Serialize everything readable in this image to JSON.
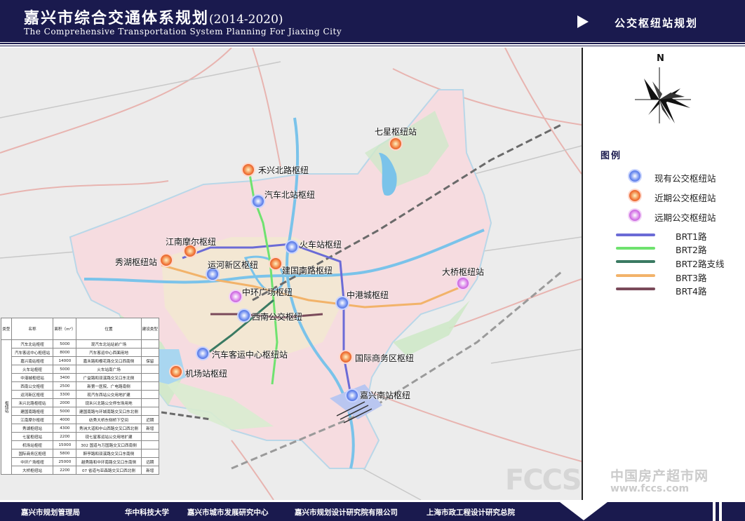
{
  "header": {
    "title": "嘉兴市综合交通体系规划",
    "years": "(2014-2020)",
    "subtitle": "The Comprehensive Transportation System Planning For Jiaxing City",
    "section_title": "公交枢纽站规划"
  },
  "compass": {
    "north_label": "N"
  },
  "legend": {
    "title": "图例",
    "items": [
      {
        "label": "现有公交枢纽站",
        "kind": "dot",
        "color": "#4a6fe0"
      },
      {
        "label": "近期公交枢纽站",
        "kind": "dot",
        "color": "#e8502a"
      },
      {
        "label": "远期公交枢纽站",
        "kind": "dot",
        "color": "#c050d8"
      },
      {
        "label": "BRT1路",
        "kind": "line",
        "color": "#6b6bd6"
      },
      {
        "label": "BRT2路",
        "kind": "line",
        "color": "#6fe26f"
      },
      {
        "label": "BRT2路支线",
        "kind": "line",
        "color": "#3a7a62"
      },
      {
        "label": "BRT3路",
        "kind": "line",
        "color": "#f2b36a"
      },
      {
        "label": "BRT4路",
        "kind": "line",
        "color": "#7a4a5a"
      }
    ]
  },
  "hubs": [
    {
      "name": "七星枢纽站",
      "type": "near"
    },
    {
      "name": "禾兴北路枢纽",
      "type": "near"
    },
    {
      "name": "汽车北站枢纽",
      "type": "existing"
    },
    {
      "name": "江南摩尔枢纽",
      "type": "near"
    },
    {
      "name": "秀湖枢纽站",
      "type": "near"
    },
    {
      "name": "运河新区枢纽",
      "type": "existing"
    },
    {
      "name": "火车站枢纽",
      "type": "existing"
    },
    {
      "name": "建国南路枢纽",
      "type": "near"
    },
    {
      "name": "大桥枢纽站",
      "type": "far"
    },
    {
      "name": "中环广场枢纽",
      "type": "far"
    },
    {
      "name": "中港城枢纽",
      "type": "existing"
    },
    {
      "name": "西南公交枢纽",
      "type": "existing"
    },
    {
      "name": "汽车客运中心枢纽站",
      "type": "existing"
    },
    {
      "name": "国际商务区枢纽",
      "type": "near"
    },
    {
      "name": "机场站枢纽",
      "type": "near"
    },
    {
      "name": "嘉兴南站枢纽",
      "type": "existing"
    }
  ],
  "table": {
    "headers": [
      "类型",
      "名称",
      "面积（m²）",
      "位置",
      "建设类型"
    ],
    "side_label": "枢纽站",
    "rows": [
      {
        "name": "汽车北站枢纽",
        "area": "5000",
        "location": "现汽车北站站前广场",
        "build": ""
      },
      {
        "name": "汽车客运中心枢纽站",
        "area": "8000",
        "location": "汽车客运中心西面用地",
        "build": ""
      },
      {
        "name": "嘉兴南站枢纽",
        "area": "14000",
        "location": "嘉禾路和樱花路交叉口西南侧",
        "build": "保留"
      },
      {
        "name": "火车站枢纽",
        "area": "5000",
        "location": "火车站南广场",
        "build": ""
      },
      {
        "name": "中港城枢纽站",
        "area": "3400",
        "location": "广益路和双溪路交叉口东北侧",
        "build": ""
      },
      {
        "name": "西南公交枢纽",
        "area": "2500",
        "location": "新第一医院、广电路南侧",
        "build": ""
      },
      {
        "name": "运河新区枢纽",
        "area": "3300",
        "location": "现汽车西站公交用地扩建",
        "build": ""
      },
      {
        "name": "禾兴北路枢纽站",
        "area": "2000",
        "location": "现禾兴北路公交停车场用地",
        "build": ""
      },
      {
        "name": "建国南路枢纽",
        "area": "5000",
        "location": "建国南路与环城南路交叉口东北侧",
        "build": ""
      },
      {
        "name": "江南摩尔枢纽",
        "area": "4000",
        "location": "纺秀大桥东侧桥下空间",
        "build": "近期"
      },
      {
        "name": "秀湖枢纽站",
        "area": "4300",
        "location": "秀洲大道和中山西路交叉口西北侧",
        "build": "新增"
      },
      {
        "name": "七星枢纽站",
        "area": "2200",
        "location": "现七星客运站公交用地扩建",
        "build": ""
      },
      {
        "name": "机场站枢纽",
        "area": "15000",
        "location": "302 国道与万国路交叉口西南侧",
        "build": ""
      },
      {
        "name": "国际商务区枢纽",
        "area": "5800",
        "location": "醉亭路和双溪路交叉口东南侧",
        "build": ""
      },
      {
        "name": "中环广场枢纽",
        "area": "25000",
        "location": "越秀路和中环南路交叉口东南侧",
        "build": "远期"
      },
      {
        "name": "大桥枢纽站",
        "area": "2200",
        "location": "07 省道与亚森路交叉口西北侧",
        "build": "新增"
      }
    ]
  },
  "footer": {
    "orgs": [
      "嘉兴市规划管理局",
      "华中科技大学",
      "嘉兴市城市发展研究中心",
      "嘉兴市规划设计研究院有限公司",
      "上海市政工程设计研究总院"
    ]
  },
  "watermark": {
    "logo": "FCCS",
    "cn": "中国房产超市网",
    "url": "www.fccs.com"
  }
}
